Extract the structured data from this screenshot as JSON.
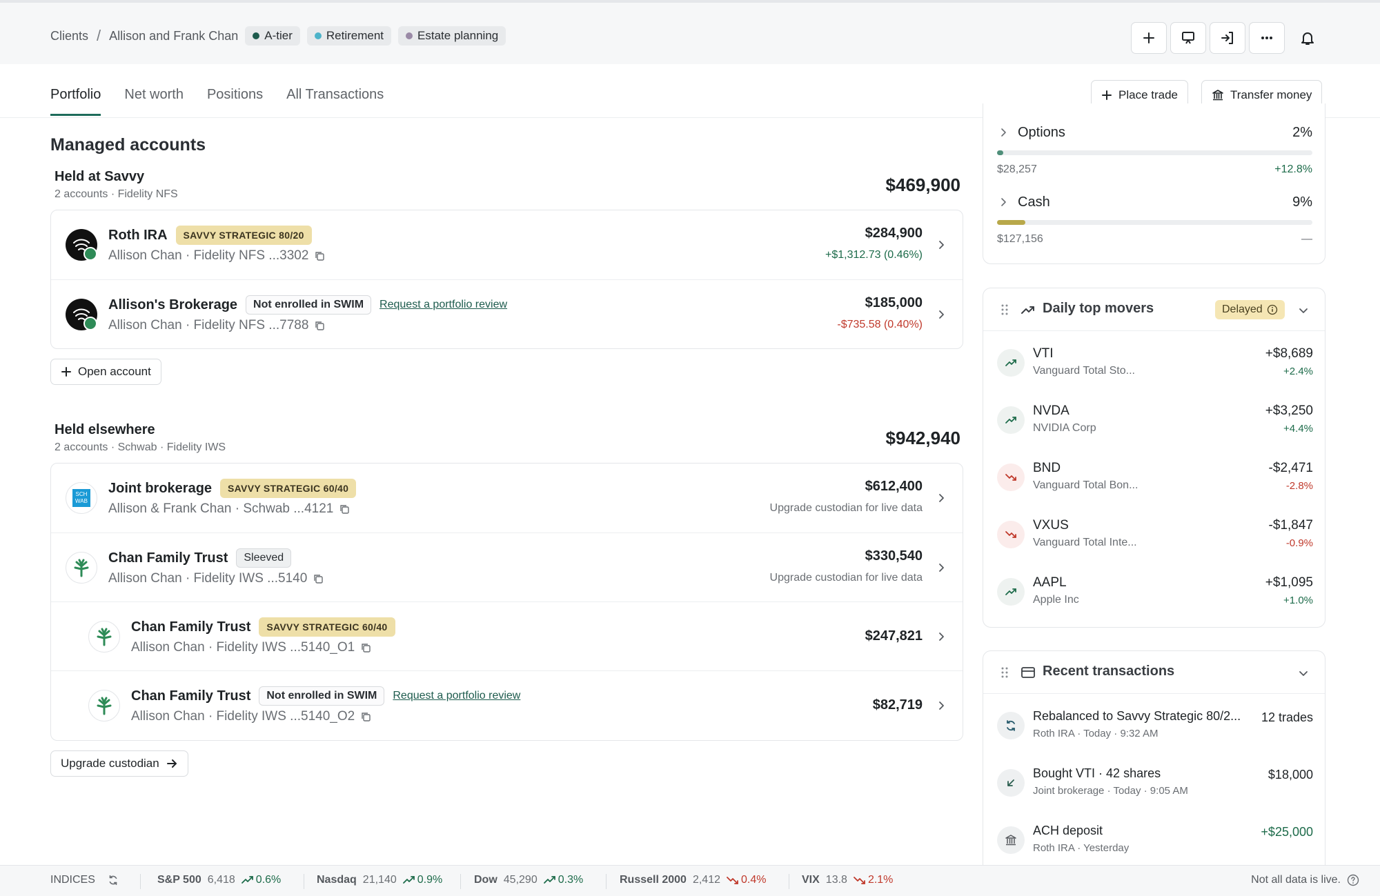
{
  "breadcrumb": {
    "root": "Clients",
    "separator": "/",
    "client": "Allison and Frank Chan",
    "tags": [
      {
        "label": "A-tier",
        "color": "#1d5b4d"
      },
      {
        "label": "Retirement",
        "color": "#4db3c9"
      },
      {
        "label": "Estate planning",
        "color": "#9a8aa6"
      }
    ]
  },
  "header_icons": [
    "plus-icon",
    "presentation-icon",
    "sign-in-icon",
    "more-icon",
    "bell-icon"
  ],
  "tabs": [
    {
      "label": "Portfolio",
      "active": true
    },
    {
      "label": "Net worth",
      "active": false
    },
    {
      "label": "Positions",
      "active": false
    },
    {
      "label": "All Transactions",
      "active": false
    }
  ],
  "actions": {
    "place_trade": "Place trade",
    "transfer_money": "Transfer money"
  },
  "managed": {
    "title": "Managed accounts",
    "savvy": {
      "title": "Held at Savvy",
      "subtitle": "2 accounts · Fidelity NFS",
      "total": "$469,900",
      "accounts": [
        {
          "name": "Roth IRA",
          "badge": "SAVVY STRATEGIC 80/20",
          "sub": "Allison Chan · Fidelity NFS ...3302",
          "value": "$284,900",
          "change": "+$1,312.73 (0.46%)"
        },
        {
          "name": "Allison's Brokerage",
          "badge": "Not enrolled in SWIM",
          "link": "Request a portfolio review",
          "sub": "Allison Chan · Fidelity NFS ...7788",
          "value": "$185,000",
          "change": "-$735.58 (0.40%)"
        }
      ],
      "open_account": "Open account"
    },
    "elsewhere": {
      "title": "Held elsewhere",
      "subtitle": "2 accounts · Schwab · Fidelity IWS",
      "total": "$942,940",
      "accounts": [
        {
          "name": "Joint brokerage",
          "badge": "SAVVY STRATEGIC 60/40",
          "sub": "Allison & Frank Chan · Schwab ...4121",
          "value": "$612,400",
          "note": "Upgrade custodian for live data",
          "logo_text": "SCH WAB"
        },
        {
          "name": "Chan Family Trust",
          "badge": "Sleeved",
          "sub": "Allison Chan · Fidelity IWS ...5140",
          "value": "$330,540",
          "note": "Upgrade custodian for live data"
        },
        {
          "name": "Chan Family Trust",
          "badge": "SAVVY STRATEGIC 60/40",
          "sub": "Allison Chan · Fidelity IWS ...5140_O1",
          "value": "$247,821"
        },
        {
          "name": "Chan Family Trust",
          "badge": "Not enrolled in SWIM",
          "link": "Request a portfolio review",
          "sub": "Allison Chan · Fidelity IWS ...5140_O2",
          "value": "$82,719"
        }
      ],
      "upgrade": "Upgrade custodian"
    }
  },
  "allocation": [
    {
      "name": "Options",
      "pct": "2%",
      "fill_fraction": 0.02,
      "fill_color": "#4f8f7a",
      "value": "$28,257",
      "change": "+12.8%"
    },
    {
      "name": "Cash",
      "pct": "9%",
      "fill_fraction": 0.09,
      "fill_color": "#b8a84a",
      "value": "$127,156",
      "change": "—"
    }
  ],
  "movers": {
    "title": "Daily top movers",
    "delayed": "Delayed",
    "items": [
      {
        "symbol": "VTI",
        "name": "Vanguard Total Sto...",
        "amount": "+$8,689",
        "pct": "+2.4%",
        "dir": "up"
      },
      {
        "symbol": "NVDA",
        "name": "NVIDIA Corp",
        "amount": "+$3,250",
        "pct": "+4.4%",
        "dir": "up"
      },
      {
        "symbol": "BND",
        "name": "Vanguard Total Bon...",
        "amount": "-$2,471",
        "pct": "-2.8%",
        "dir": "down"
      },
      {
        "symbol": "VXUS",
        "name": "Vanguard Total Inte...",
        "amount": "-$1,847",
        "pct": "-0.9%",
        "dir": "down"
      },
      {
        "symbol": "AAPL",
        "name": "Apple Inc",
        "amount": "+$1,095",
        "pct": "+1.0%",
        "dir": "up"
      }
    ]
  },
  "transactions": {
    "title": "Recent transactions",
    "items": [
      {
        "title": "Rebalanced to Savvy Strategic 80/2...",
        "sub": "Roth IRA · Today · 9:32 AM",
        "amount": "12 trades",
        "icon": "refresh-icon"
      },
      {
        "title": "Bought VTI · 42 shares",
        "sub": "Joint brokerage · Today · 9:05 AM",
        "amount": "$18,000",
        "icon": "arrow-down-left-icon"
      },
      {
        "title": "ACH deposit",
        "sub": "Roth IRA · Yesterday",
        "amount": "+$25,000",
        "icon": "bank-icon"
      }
    ]
  },
  "indices": {
    "label": "INDICES",
    "items": [
      {
        "name": "S&P 500",
        "value": "6,418",
        "change": "0.6%",
        "dir": "up"
      },
      {
        "name": "Nasdaq",
        "value": "21,140",
        "change": "0.9%",
        "dir": "up"
      },
      {
        "name": "Dow",
        "value": "45,290",
        "change": "0.3%",
        "dir": "up"
      },
      {
        "name": "Russell 2000",
        "value": "2,412",
        "change": "0.4%",
        "dir": "down"
      },
      {
        "name": "VIX",
        "value": "13.8",
        "change": "2.1%",
        "dir": "down"
      }
    ],
    "note": "Not all data is live."
  }
}
